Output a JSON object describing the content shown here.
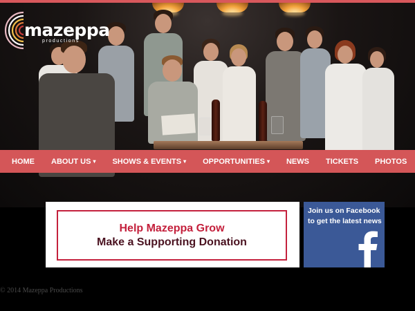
{
  "brand": {
    "name": "mazeppa",
    "subtitle": "productions",
    "colors": {
      "nav": "#d45658",
      "donate_accent": "#c4203c",
      "facebook": "#3b5997"
    }
  },
  "nav": {
    "items": [
      {
        "label": "HOME",
        "has_dropdown": false
      },
      {
        "label": "ABOUT US",
        "has_dropdown": true
      },
      {
        "label": "SHOWS & EVENTS",
        "has_dropdown": true
      },
      {
        "label": "OPPORTUNITIES",
        "has_dropdown": true
      },
      {
        "label": "NEWS",
        "has_dropdown": false
      },
      {
        "label": "TICKETS",
        "has_dropdown": false
      },
      {
        "label": "PHOTOS",
        "has_dropdown": false
      }
    ],
    "caret": "▾"
  },
  "donate": {
    "line1": "Help Mazeppa Grow",
    "line2": "Make a Supporting Donation"
  },
  "facebook": {
    "line1": "Join us on Facebook",
    "line2": "to get the latest news",
    "icon": "facebook-f-icon"
  },
  "footer": {
    "copyright": "© 2014 Mazeppa Productions"
  }
}
